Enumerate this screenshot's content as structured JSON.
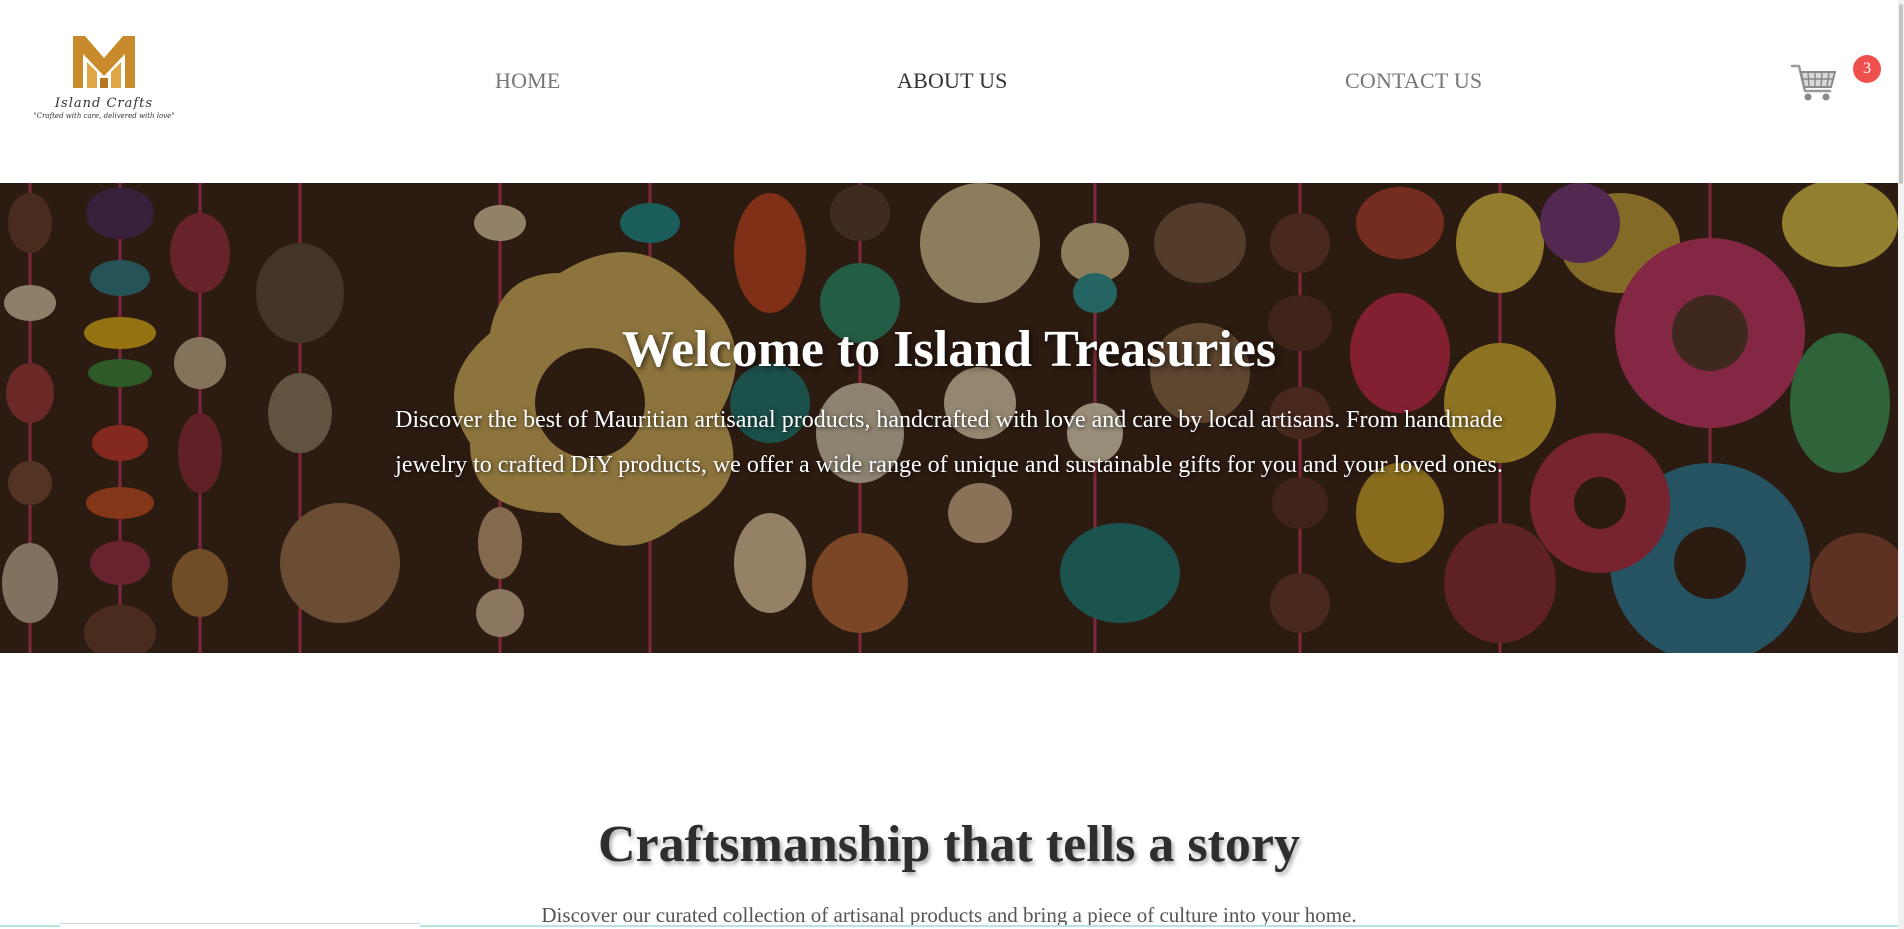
{
  "brand": {
    "name": "Island Crafts",
    "tagline": "\"Crafted with care, delivered with love\"",
    "gold_color": "#c98a2b"
  },
  "nav": {
    "home": "HOME",
    "about": "ABOUT US",
    "contact": "CONTACT US",
    "active": "ABOUT US"
  },
  "cart": {
    "icon": "shopping-cart-icon",
    "count": "3",
    "badge_color": "#f0504d"
  },
  "hero": {
    "title": "Welcome to Island Treasuries",
    "text": "Discover the best of Mauritian artisanal products, handcrafted with love and care by local artisans. From handmade jewelry to crafted DIY products, we offer a wide range of unique and sustainable gifts for you and your loved ones.",
    "background": "colorful coconut-shell beads"
  },
  "section": {
    "title": "Craftsmanship that tells a story",
    "text": "Discover our curated collection of artisanal products and bring a piece of culture into your home."
  }
}
